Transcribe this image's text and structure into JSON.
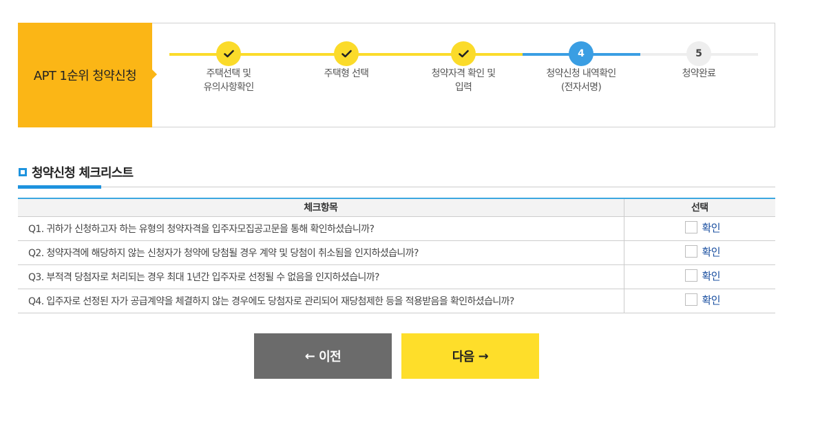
{
  "banner": {
    "title": "APT 1순위 청약신청",
    "steps": [
      {
        "num": "",
        "state": "done",
        "label": "주택선택 및\n유의사항확인"
      },
      {
        "num": "",
        "state": "done",
        "label": "주택형 선택"
      },
      {
        "num": "",
        "state": "done",
        "label": "청약자격 확인 및\n입력"
      },
      {
        "num": "4",
        "state": "current",
        "label": "청약신청 내역확인\n(전자서명)"
      },
      {
        "num": "5",
        "state": "todo",
        "label": "청약완료"
      }
    ]
  },
  "section": {
    "title": "청약신청 체크리스트"
  },
  "table": {
    "headers": [
      "체크항목",
      "선택"
    ],
    "rows": [
      {
        "question": "Q1. 귀하가 신청하고자 하는 유형의 청약자격을 입주자모집공고문을 통해 확인하셨습니까?",
        "option": "확인"
      },
      {
        "question": "Q2. 청약자격에 해당하지 않는 신청자가 청약에 당첨될 경우 계약 및 당첨이 취소됨을 인지하셨습니까?",
        "option": "확인"
      },
      {
        "question": "Q3. 부적격 당첨자로 처리되는 경우 최대 1년간 입주자로 선정될 수 없음을 인지하셨습니까?",
        "option": "확인"
      },
      {
        "question": "Q4. 입주자로 선정된 자가 공급계약을 체결하지 않는 경우에도 당첨자로 관리되어 재당첨제한 등을 적용받음을 확인하셨습니까?",
        "option": "확인"
      }
    ]
  },
  "buttons": {
    "prev": {
      "arrow": "←",
      "label": "이전"
    },
    "next": {
      "label": "다음",
      "arrow": "→"
    }
  },
  "colors": {
    "banner": "#fbb616",
    "done": "#fbdb2a",
    "current": "#3a9ee3",
    "next_button": "#fede2a",
    "prev_button": "#6b6b6b"
  }
}
